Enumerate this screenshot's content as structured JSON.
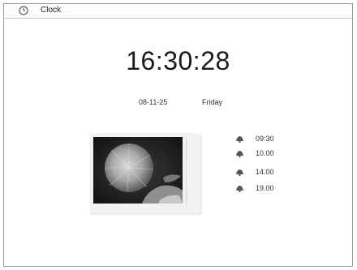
{
  "window": {
    "title": "Clock",
    "icon": "clock-icon"
  },
  "clock": {
    "time": "16:30:28",
    "date": "08-11-25",
    "day": "Friday"
  },
  "photo": {
    "icon": "sunflower-photo"
  },
  "alarms": [
    {
      "time": "09:30",
      "icon": "bell-icon"
    },
    {
      "time": "10.00",
      "icon": "bell-icon"
    },
    {
      "time": "14.00",
      "icon": "bell-icon"
    },
    {
      "time": "19.00",
      "icon": "bell-icon"
    }
  ]
}
